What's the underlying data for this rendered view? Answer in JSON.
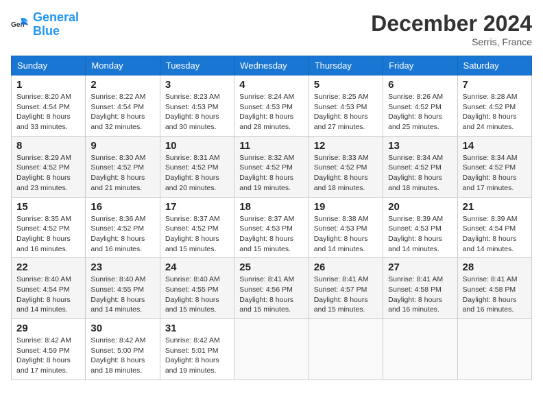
{
  "header": {
    "logo_general": "General",
    "logo_blue": "Blue",
    "month": "December 2024",
    "location": "Serris, France"
  },
  "days_of_week": [
    "Sunday",
    "Monday",
    "Tuesday",
    "Wednesday",
    "Thursday",
    "Friday",
    "Saturday"
  ],
  "weeks": [
    [
      {
        "num": "1",
        "sunrise": "8:20 AM",
        "sunset": "4:54 PM",
        "daylight": "8 hours and 33 minutes."
      },
      {
        "num": "2",
        "sunrise": "8:22 AM",
        "sunset": "4:54 PM",
        "daylight": "8 hours and 32 minutes."
      },
      {
        "num": "3",
        "sunrise": "8:23 AM",
        "sunset": "4:53 PM",
        "daylight": "8 hours and 30 minutes."
      },
      {
        "num": "4",
        "sunrise": "8:24 AM",
        "sunset": "4:53 PM",
        "daylight": "8 hours and 28 minutes."
      },
      {
        "num": "5",
        "sunrise": "8:25 AM",
        "sunset": "4:53 PM",
        "daylight": "8 hours and 27 minutes."
      },
      {
        "num": "6",
        "sunrise": "8:26 AM",
        "sunset": "4:52 PM",
        "daylight": "8 hours and 25 minutes."
      },
      {
        "num": "7",
        "sunrise": "8:28 AM",
        "sunset": "4:52 PM",
        "daylight": "8 hours and 24 minutes."
      }
    ],
    [
      {
        "num": "8",
        "sunrise": "8:29 AM",
        "sunset": "4:52 PM",
        "daylight": "8 hours and 23 minutes."
      },
      {
        "num": "9",
        "sunrise": "8:30 AM",
        "sunset": "4:52 PM",
        "daylight": "8 hours and 21 minutes."
      },
      {
        "num": "10",
        "sunrise": "8:31 AM",
        "sunset": "4:52 PM",
        "daylight": "8 hours and 20 minutes."
      },
      {
        "num": "11",
        "sunrise": "8:32 AM",
        "sunset": "4:52 PM",
        "daylight": "8 hours and 19 minutes."
      },
      {
        "num": "12",
        "sunrise": "8:33 AM",
        "sunset": "4:52 PM",
        "daylight": "8 hours and 18 minutes."
      },
      {
        "num": "13",
        "sunrise": "8:34 AM",
        "sunset": "4:52 PM",
        "daylight": "8 hours and 18 minutes."
      },
      {
        "num": "14",
        "sunrise": "8:34 AM",
        "sunset": "4:52 PM",
        "daylight": "8 hours and 17 minutes."
      }
    ],
    [
      {
        "num": "15",
        "sunrise": "8:35 AM",
        "sunset": "4:52 PM",
        "daylight": "8 hours and 16 minutes."
      },
      {
        "num": "16",
        "sunrise": "8:36 AM",
        "sunset": "4:52 PM",
        "daylight": "8 hours and 16 minutes."
      },
      {
        "num": "17",
        "sunrise": "8:37 AM",
        "sunset": "4:52 PM",
        "daylight": "8 hours and 15 minutes."
      },
      {
        "num": "18",
        "sunrise": "8:37 AM",
        "sunset": "4:53 PM",
        "daylight": "8 hours and 15 minutes."
      },
      {
        "num": "19",
        "sunrise": "8:38 AM",
        "sunset": "4:53 PM",
        "daylight": "8 hours and 14 minutes."
      },
      {
        "num": "20",
        "sunrise": "8:39 AM",
        "sunset": "4:53 PM",
        "daylight": "8 hours and 14 minutes."
      },
      {
        "num": "21",
        "sunrise": "8:39 AM",
        "sunset": "4:54 PM",
        "daylight": "8 hours and 14 minutes."
      }
    ],
    [
      {
        "num": "22",
        "sunrise": "8:40 AM",
        "sunset": "4:54 PM",
        "daylight": "8 hours and 14 minutes."
      },
      {
        "num": "23",
        "sunrise": "8:40 AM",
        "sunset": "4:55 PM",
        "daylight": "8 hours and 14 minutes."
      },
      {
        "num": "24",
        "sunrise": "8:40 AM",
        "sunset": "4:55 PM",
        "daylight": "8 hours and 15 minutes."
      },
      {
        "num": "25",
        "sunrise": "8:41 AM",
        "sunset": "4:56 PM",
        "daylight": "8 hours and 15 minutes."
      },
      {
        "num": "26",
        "sunrise": "8:41 AM",
        "sunset": "4:57 PM",
        "daylight": "8 hours and 15 minutes."
      },
      {
        "num": "27",
        "sunrise": "8:41 AM",
        "sunset": "4:58 PM",
        "daylight": "8 hours and 16 minutes."
      },
      {
        "num": "28",
        "sunrise": "8:41 AM",
        "sunset": "4:58 PM",
        "daylight": "8 hours and 16 minutes."
      }
    ],
    [
      {
        "num": "29",
        "sunrise": "8:42 AM",
        "sunset": "4:59 PM",
        "daylight": "8 hours and 17 minutes."
      },
      {
        "num": "30",
        "sunrise": "8:42 AM",
        "sunset": "5:00 PM",
        "daylight": "8 hours and 18 minutes."
      },
      {
        "num": "31",
        "sunrise": "8:42 AM",
        "sunset": "5:01 PM",
        "daylight": "8 hours and 19 minutes."
      },
      null,
      null,
      null,
      null
    ]
  ]
}
